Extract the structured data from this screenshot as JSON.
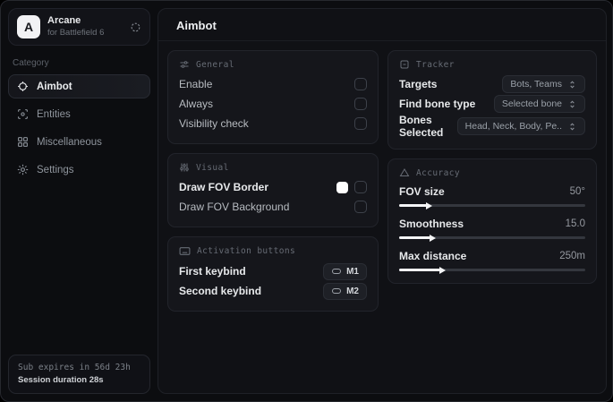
{
  "sidebar": {
    "brand": {
      "initial": "A",
      "name": "Arcane",
      "subtitle": "for Battlefield 6"
    },
    "category_label": "Category",
    "items": [
      {
        "label": "Aimbot"
      },
      {
        "label": "Entities"
      },
      {
        "label": "Miscellaneous"
      },
      {
        "label": "Settings"
      }
    ],
    "footer": {
      "line1": "Sub expires in 56d 23h",
      "line2": "Session duration 28s"
    }
  },
  "main": {
    "title": "Aimbot",
    "general": {
      "title": "General",
      "rows": [
        {
          "label": "Enable",
          "checked": false
        },
        {
          "label": "Always",
          "checked": false
        },
        {
          "label": "Visibility check",
          "checked": false
        }
      ]
    },
    "visual": {
      "title": "Visual",
      "rows": [
        {
          "label": "Draw FOV Border",
          "swatch": "#ffffff",
          "checked": false
        },
        {
          "label": "Draw FOV Background",
          "checked": false
        }
      ]
    },
    "activation": {
      "title": "Activation buttons",
      "rows": [
        {
          "label": "First keybind",
          "key": "M1"
        },
        {
          "label": "Second keybind",
          "key": "M2"
        }
      ]
    },
    "tracker": {
      "title": "Tracker",
      "rows": [
        {
          "label": "Targets",
          "value": "Bots, Teams"
        },
        {
          "label": "Find bone type",
          "value": "Selected bone"
        },
        {
          "label": "Bones Selected",
          "value": "Head, Neck, Body, Pe.."
        }
      ]
    },
    "accuracy": {
      "title": "Accuracy",
      "rows": [
        {
          "label": "FOV size",
          "value": "50°",
          "percent": 15
        },
        {
          "label": "Smoothness",
          "value": "15.0",
          "percent": 17
        },
        {
          "label": "Max distance",
          "value": "250m",
          "percent": 22
        }
      ]
    }
  },
  "colors": {
    "accent": "#f4f5f6",
    "swatch_fov_border": "#ffffff"
  }
}
